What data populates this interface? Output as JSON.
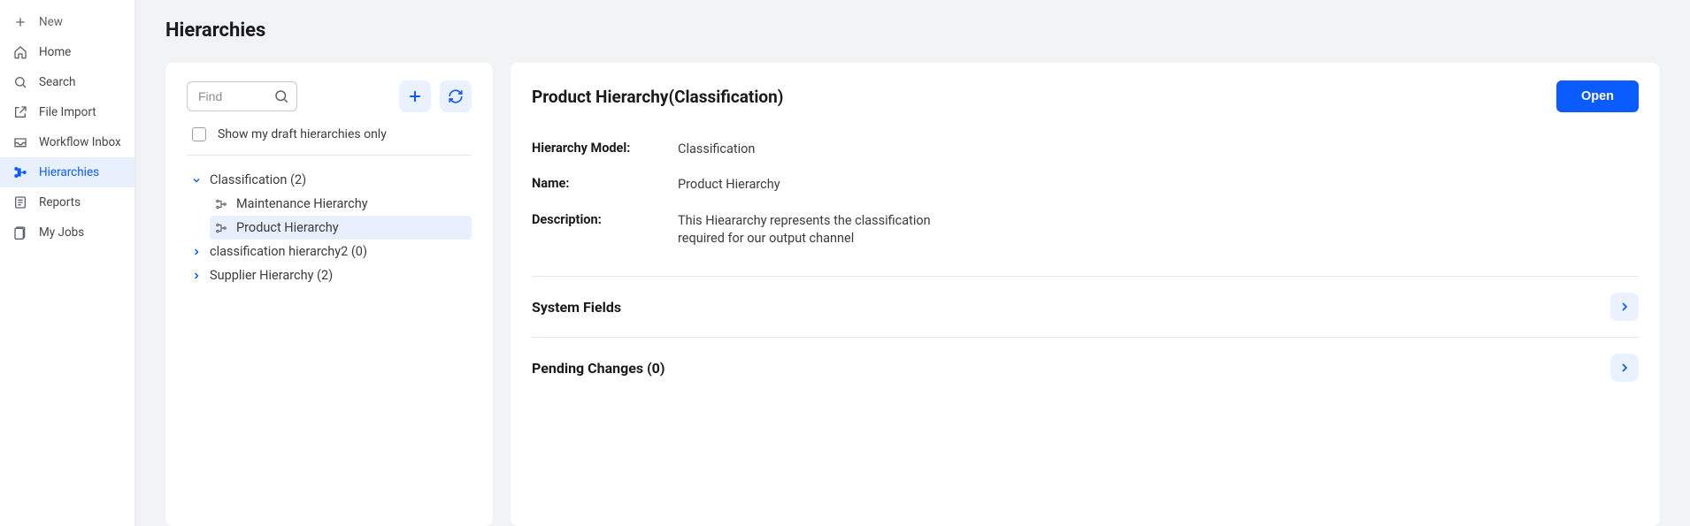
{
  "sidebar": {
    "new_label": "New",
    "items": [
      {
        "label": "Home"
      },
      {
        "label": "Search"
      },
      {
        "label": "File Import"
      },
      {
        "label": "Workflow Inbox"
      },
      {
        "label": "Hierarchies"
      },
      {
        "label": "Reports"
      },
      {
        "label": "My Jobs"
      }
    ]
  },
  "page": {
    "title": "Hierarchies"
  },
  "left_panel": {
    "find_placeholder": "Find",
    "draft_label": "Show my draft hierarchies only",
    "tree": {
      "groups": [
        {
          "label": "Classification (2)",
          "expanded": true,
          "children": [
            {
              "label": "Maintenance Hierarchy",
              "selected": false
            },
            {
              "label": "Product Hierarchy",
              "selected": true
            }
          ]
        },
        {
          "label": "classification hierarchy2 (0)",
          "expanded": false
        },
        {
          "label": "Supplier Hierarchy (2)",
          "expanded": false
        }
      ]
    }
  },
  "detail": {
    "title": "Product Hierarchy(Classification)",
    "open_label": "Open",
    "fields": {
      "model_label": "Hierarchy Model:",
      "model_value": "Classification",
      "name_label": "Name:",
      "name_value": "Product Hierarchy",
      "desc_label": "Description:",
      "desc_value": "This Hieararchy represents the classification required for our output channel"
    },
    "sections": {
      "system_fields": "System Fields",
      "pending_changes": "Pending Changes (0)"
    }
  }
}
